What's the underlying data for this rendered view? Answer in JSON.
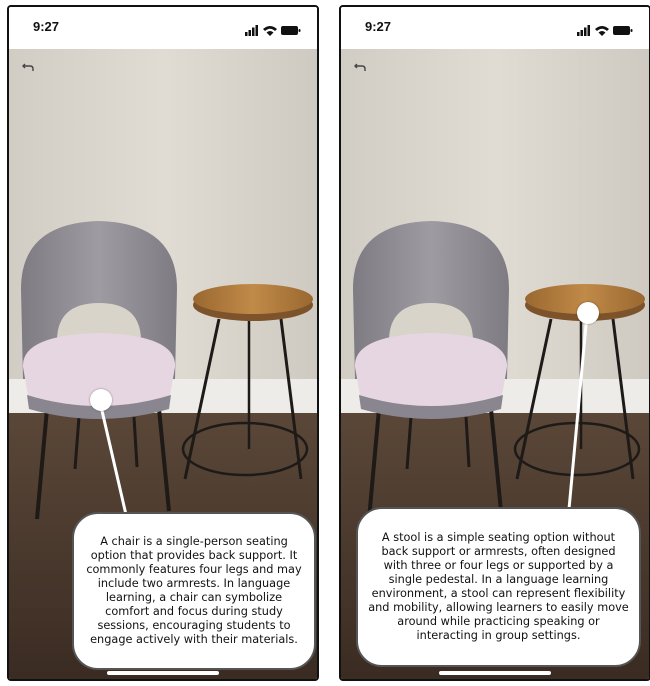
{
  "screens": [
    {
      "status_time": "9:27",
      "description_text": "A chair is a single-person seating option that provides back support. It commonly features four legs and may include two armrests. In language learning, a chair can symbolize comfort and focus during study sessions, encouraging students to engage actively with their materials."
    },
    {
      "status_time": "9:27",
      "description_text": "A stool is a simple seating option without back support or armrests, often designed with three or four legs or supported by a single pedestal. In a language learning environment, a stool can represent flexibility and mobility, allowing learners to easily move around while practicing speaking or interacting in group settings."
    }
  ],
  "icons": {
    "back": "back-arrow-icon",
    "signal": "signal-icon",
    "wifi": "wifi-icon",
    "battery": "battery-icon"
  },
  "colors": {
    "wall": "#d9d4ca",
    "floor": "#4a3a2f",
    "chair_back": "#8f8c92",
    "chair_seat": "#e4d3df",
    "stool_top": "#b07a3a",
    "callout_border": "#555555"
  }
}
